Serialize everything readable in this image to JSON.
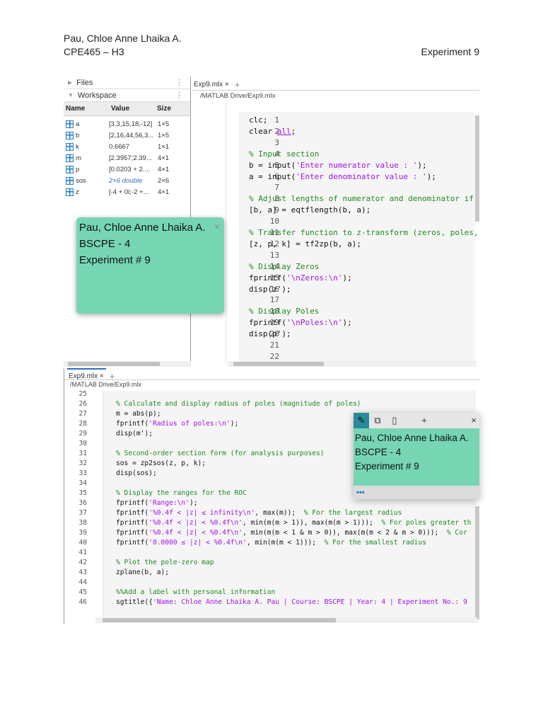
{
  "header": {
    "name": "Pau, Chloe Anne Lhaika A.",
    "course": "CPE465 – H3",
    "experiment": "Experiment 9"
  },
  "workspace": {
    "files_label": "Files",
    "workspace_label": "Workspace",
    "columns": [
      "Name",
      "Value",
      "Size"
    ],
    "rows": [
      {
        "name": "a",
        "value": "[3,3,15,18,-12]",
        "size": "1×5"
      },
      {
        "name": "b",
        "value": "[2,16,44,56,3...",
        "size": "1×5"
      },
      {
        "name": "k",
        "value": "0.6667",
        "size": "1×1"
      },
      {
        "name": "m",
        "value": "[2.3957;2.39...",
        "size": "4×1"
      },
      {
        "name": "p",
        "value": "[0.0203 + 2....",
        "size": "4×1"
      },
      {
        "name": "sos",
        "value": "2×6 double",
        "size": "2×6"
      },
      {
        "name": "z",
        "value": "[-4 + 0i;-2 +...",
        "size": "4×1"
      }
    ]
  },
  "top_editor": {
    "tab": "Exp9.mlx",
    "path": "/MATLAB Drive/Exp9.mlx",
    "lines": [
      {
        "n": "1",
        "tokens": [
          [
            "c",
            "clc;"
          ]
        ]
      },
      {
        "n": "2",
        "tokens": [
          [
            "c",
            "clear "
          ],
          [
            "u",
            "all"
          ],
          [
            "c",
            ";"
          ]
        ]
      },
      {
        "n": "3",
        "tokens": []
      },
      {
        "n": "4",
        "tokens": [
          [
            "m",
            "% Input section"
          ]
        ]
      },
      {
        "n": "5",
        "tokens": [
          [
            "c",
            "b = input("
          ],
          [
            "s",
            "'Enter numerator value : '"
          ],
          [
            "c",
            ");"
          ]
        ]
      },
      {
        "n": "6",
        "tokens": [
          [
            "c",
            "a = input("
          ],
          [
            "s",
            "'Enter denominator value : '"
          ],
          [
            "c",
            ");"
          ]
        ]
      },
      {
        "n": "7",
        "tokens": []
      },
      {
        "n": "8",
        "tokens": [
          [
            "m",
            "% Adjust lengths of numerator and denominator if"
          ]
        ]
      },
      {
        "n": "9",
        "tokens": [
          [
            "c",
            "[b, a] = eqtflength(b, a);"
          ]
        ]
      },
      {
        "n": "10",
        "tokens": []
      },
      {
        "n": "11",
        "tokens": [
          [
            "m",
            "% Transfer function to z-transform (zeros, poles,"
          ]
        ]
      },
      {
        "n": "12",
        "tokens": [
          [
            "c",
            "[z, p, k] = tf2zp(b, a);"
          ]
        ]
      },
      {
        "n": "13",
        "tokens": []
      },
      {
        "n": "14",
        "tokens": [
          [
            "m",
            "% Display Zeros"
          ]
        ]
      },
      {
        "n": "15",
        "tokens": [
          [
            "c",
            "fprintf("
          ],
          [
            "s",
            "'\\nZeros:\\n'"
          ],
          [
            "c",
            ");"
          ]
        ]
      },
      {
        "n": "16",
        "tokens": [
          [
            "c",
            "disp(z');"
          ]
        ]
      },
      {
        "n": "17",
        "tokens": []
      },
      {
        "n": "18",
        "tokens": [
          [
            "m",
            "% Display Poles"
          ]
        ]
      },
      {
        "n": "19",
        "tokens": [
          [
            "c",
            "fprintf("
          ],
          [
            "s",
            "'\\nPoles:\\n'"
          ],
          [
            "c",
            ");"
          ]
        ]
      },
      {
        "n": "20",
        "tokens": [
          [
            "c",
            "disp(p');"
          ]
        ]
      },
      {
        "n": "21",
        "tokens": []
      },
      {
        "n": "22",
        "tokens": []
      }
    ]
  },
  "bottom_editor": {
    "tab": "Exp9.mlx",
    "path": "/MATLAB Drive/Exp9.mlx",
    "lines": [
      {
        "n": "25",
        "tokens": []
      },
      {
        "n": "26",
        "tokens": [
          [
            "m",
            "% Calculate and display radius of poles (magnitude of poles)"
          ]
        ]
      },
      {
        "n": "27",
        "tokens": [
          [
            "c",
            "m = abs(p);"
          ]
        ]
      },
      {
        "n": "28",
        "tokens": [
          [
            "c",
            "fprintf("
          ],
          [
            "s",
            "'Radius of poles:\\n'"
          ],
          [
            "c",
            ");"
          ]
        ]
      },
      {
        "n": "29",
        "tokens": [
          [
            "c",
            "disp(m');"
          ]
        ]
      },
      {
        "n": "30",
        "tokens": []
      },
      {
        "n": "31",
        "tokens": [
          [
            "m",
            "% Second-order section form (for analysis purposes)"
          ]
        ]
      },
      {
        "n": "32",
        "tokens": [
          [
            "c",
            "sos = zp2sos(z, p, k);"
          ]
        ]
      },
      {
        "n": "33",
        "tokens": [
          [
            "c",
            "disp(sos);"
          ]
        ]
      },
      {
        "n": "34",
        "tokens": []
      },
      {
        "n": "35",
        "tokens": [
          [
            "m",
            "% Display the ranges for the ROC"
          ]
        ]
      },
      {
        "n": "36",
        "tokens": [
          [
            "c",
            "fprintf("
          ],
          [
            "s",
            "'Range:\\n'"
          ],
          [
            "c",
            ");"
          ]
        ]
      },
      {
        "n": "37",
        "tokens": [
          [
            "c",
            "fprintf("
          ],
          [
            "s",
            "'%0.4f < |z| ≤ infinity\\n'"
          ],
          [
            "c",
            ", max(m));  "
          ],
          [
            "m",
            "% For the largest radius"
          ]
        ]
      },
      {
        "n": "38",
        "tokens": [
          [
            "c",
            "fprintf("
          ],
          [
            "s",
            "'%0.4f < |z| < %0.4f\\n'"
          ],
          [
            "c",
            ", min(m(m > 1)), max(m(m > 1)));  "
          ],
          [
            "m",
            "% For poles greater th"
          ]
        ]
      },
      {
        "n": "39",
        "tokens": [
          [
            "c",
            "fprintf("
          ],
          [
            "s",
            "'%0.4f < |z| < %0.4f\\n'"
          ],
          [
            "c",
            ", min(m(m < 1 & m > 0)), max(m(m < 2 & m > 0)));  "
          ],
          [
            "m",
            "% Cor"
          ]
        ]
      },
      {
        "n": "40",
        "tokens": [
          [
            "c",
            "fprintf("
          ],
          [
            "s",
            "'0.0000 ≤ |z| < %0.4f\\n'"
          ],
          [
            "c",
            ", min(m(m < 1)));  "
          ],
          [
            "m",
            "% For the smallest radius"
          ]
        ]
      },
      {
        "n": "41",
        "tokens": []
      },
      {
        "n": "42",
        "tokens": [
          [
            "m",
            "% Plot the pole-zero map"
          ]
        ]
      },
      {
        "n": "43",
        "tokens": [
          [
            "c",
            "zplane(b, a);"
          ]
        ]
      },
      {
        "n": "44",
        "tokens": []
      },
      {
        "n": "45",
        "tokens": [
          [
            "m",
            "%%Add a label with personal information"
          ]
        ]
      },
      {
        "n": "46",
        "tokens": [
          [
            "c",
            "sgtitle({"
          ],
          [
            "s",
            "'Name: Chloe Anne Lhaika A. Pau | Course: BSCPE | Year: 4 | Experiment No.: 9"
          ]
        ]
      }
    ]
  },
  "sticky_note_1": {
    "lines": [
      "Pau, Chloe Anne Lhaika A.",
      "BSCPE - 4",
      "Experiment # 9"
    ],
    "close": "×"
  },
  "sticky_note_2": {
    "lines": [
      "Pau, Chloe Anne Lhaika A.",
      "BSCPE - 4",
      "Experiment # 9"
    ],
    "add": "+",
    "close": "×",
    "more": "•••"
  },
  "colors": {
    "note": "#76d6b4",
    "string": "#a212e8",
    "comment": "#1f8a1f",
    "pin_active": "#2a8a9a"
  }
}
